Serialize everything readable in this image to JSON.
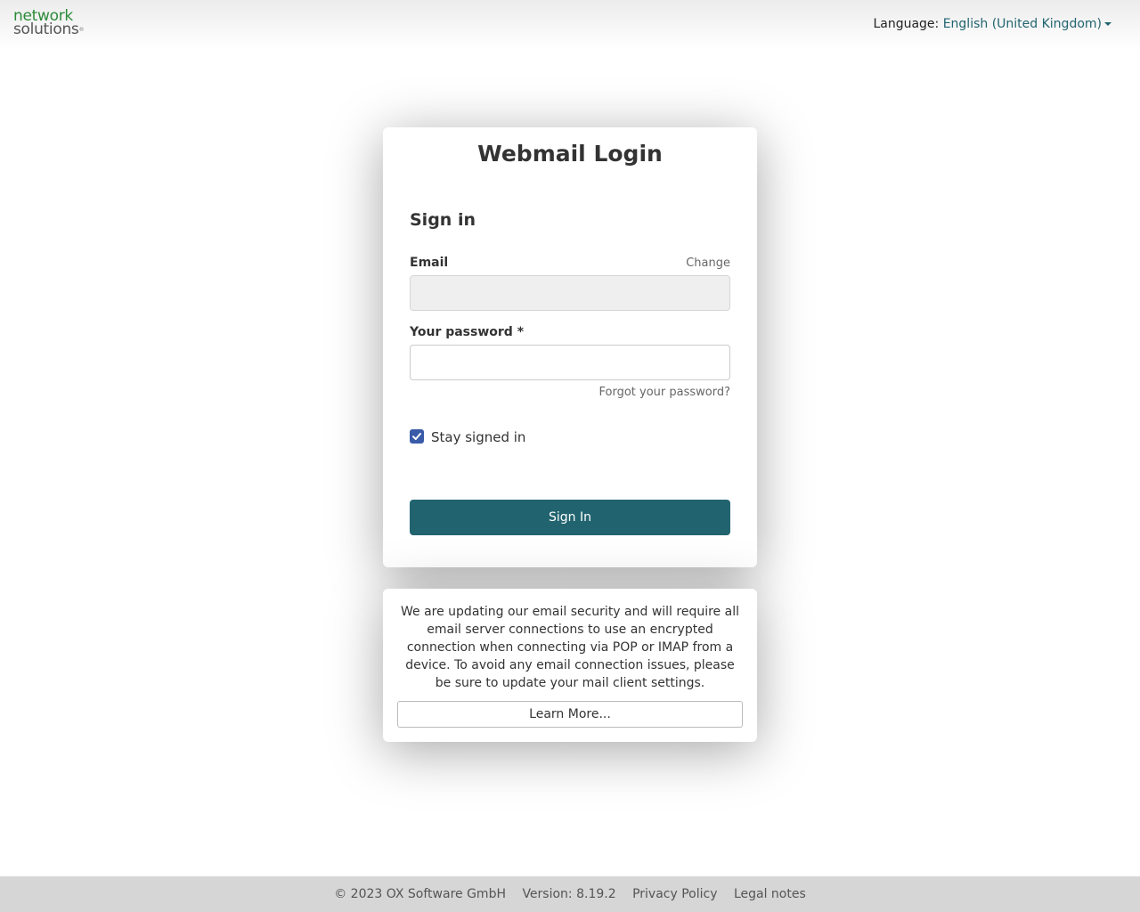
{
  "header": {
    "logo_line1": "network",
    "logo_line2": "solutions",
    "logo_mark": "®",
    "language_label": "Language:",
    "language_value": "English (United Kingdom)"
  },
  "login": {
    "title": "Webmail Login",
    "heading": "Sign in",
    "email_label": "Email",
    "change_link": "Change",
    "email_value": "",
    "password_label": "Your password *",
    "password_value": "",
    "forgot_link": "Forgot your password?",
    "stay_signed_in_label": "Stay signed in",
    "stay_signed_in_checked": true,
    "submit_label": "Sign In"
  },
  "notice": {
    "text": "We are updating our email security and will require all email server connections to use an encrypted connection when connecting via POP or IMAP from a device. To avoid any email connection issues, please be sure to update your mail client settings.",
    "button_label": "Learn More..."
  },
  "footer": {
    "copyright": "© 2023 OX Software GmbH",
    "version": "Version: 8.19.2",
    "privacy": "Privacy Policy",
    "legal": "Legal notes"
  },
  "colors": {
    "primary": "#216470",
    "checkbox": "#3a5ba8",
    "logo_green": "#2c8a3a"
  }
}
